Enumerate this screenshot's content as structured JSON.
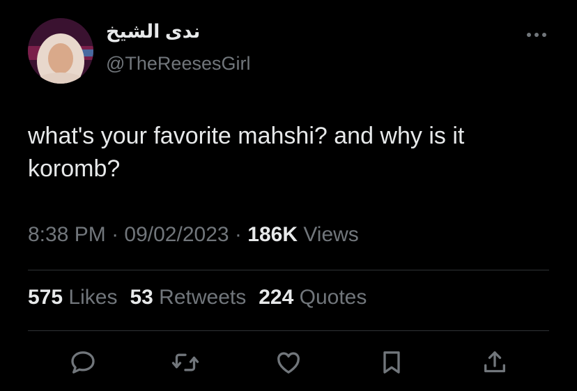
{
  "author": {
    "display_name": "ندى الشيخ",
    "handle": "@TheReesesGirl"
  },
  "tweet": {
    "text_line1": "what's your favorite mahshi? and why is it",
    "text_line2": "koromb?"
  },
  "meta": {
    "time": "8:38 PM",
    "separator": "·",
    "date": "09/02/2023",
    "views_count": "186K",
    "views_label": "Views"
  },
  "stats": {
    "likes_count": "575",
    "likes_label": "Likes",
    "retweets_count": "53",
    "retweets_label": "Retweets",
    "quotes_count": "224",
    "quotes_label": "Quotes"
  },
  "actions": [
    "reply-icon",
    "retweet-icon",
    "like-icon",
    "bookmark-icon",
    "share-icon"
  ],
  "colors": {
    "background": "#000000",
    "primary_text": "#e7e9ea",
    "secondary_text": "#71767b",
    "divider": "#2f3336"
  }
}
